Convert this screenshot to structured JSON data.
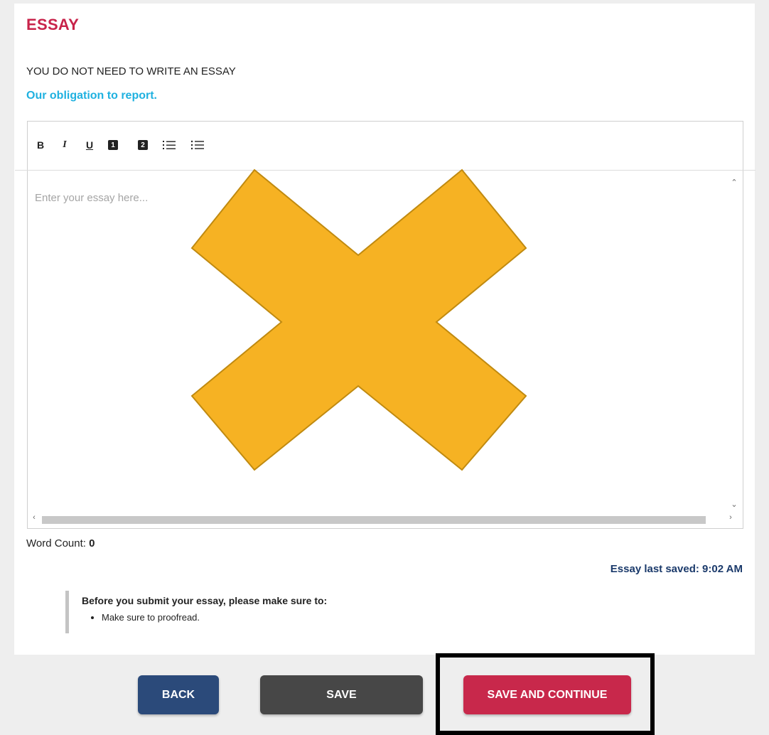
{
  "essay": {
    "title": "ESSAY",
    "instruction": "YOU DO NOT NEED TO WRITE AN ESSAY",
    "topic": "Our obligation to report."
  },
  "toolbar": {
    "bold": "B",
    "italic": "I",
    "underline": "U",
    "heading1": "1",
    "heading2": "2"
  },
  "editor": {
    "placeholder": "Enter your essay here..."
  },
  "word_count": {
    "label": "Word Count:",
    "value": "0"
  },
  "last_saved": "Essay last saved: 9:02 AM",
  "reminder": {
    "title": "Before you submit your essay, please make sure to:",
    "items": [
      "Make sure to proofread."
    ]
  },
  "buttons": {
    "back": "BACK",
    "save": "SAVE",
    "save_continue": "SAVE AND CONTINUE"
  },
  "colors": {
    "accent": "#c8234a",
    "link": "#1fb1e0",
    "back_button": "#2b4a7a",
    "save_button": "#474747",
    "save_continue_button": "#c8284b",
    "overlay_x": "#f6b223"
  },
  "icons": [
    "ordered-list-icon",
    "bulleted-list-icon",
    "scroll-up-icon",
    "scroll-down-icon",
    "scroll-left-icon",
    "scroll-right-icon",
    "cross-mark-icon"
  ]
}
